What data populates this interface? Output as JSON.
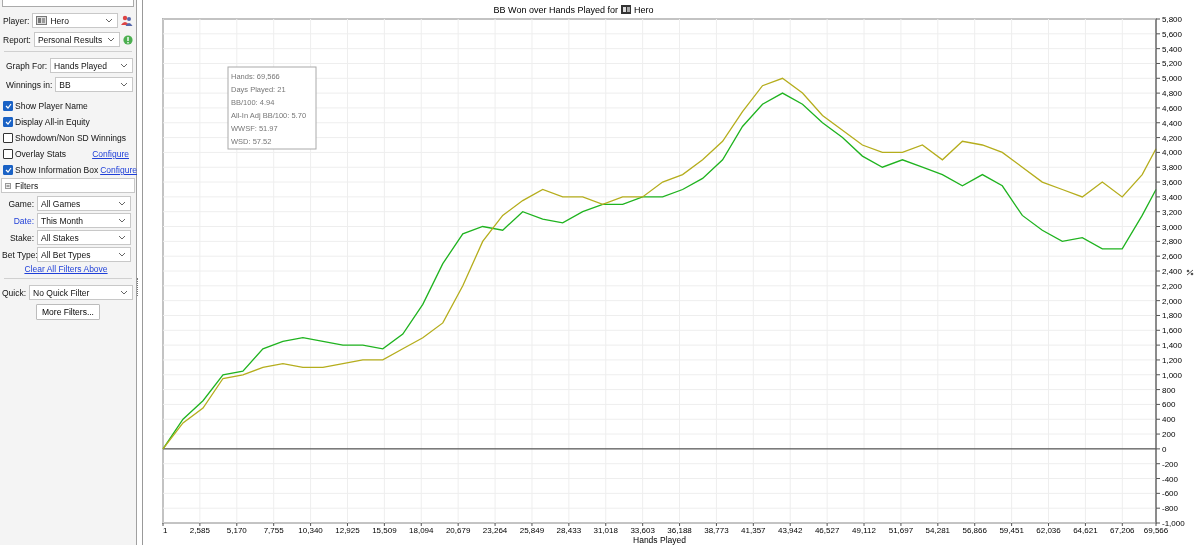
{
  "sidebar": {
    "player": {
      "label": "Player:",
      "value": "Hero"
    },
    "report": {
      "label": "Report:",
      "value": "Personal Results"
    },
    "graph_for": {
      "label": "Graph For:",
      "value": "Hands Played"
    },
    "winnings_in": {
      "label": "Winnings in:",
      "value": "BB"
    },
    "options": [
      {
        "label": "Show Player Name",
        "checked": true
      },
      {
        "label": "Display All-in Equity",
        "checked": true
      },
      {
        "label": "Showdown/Non SD Winnings",
        "checked": false
      },
      {
        "label": "Overlay Stats",
        "checked": false,
        "link": "Configure"
      },
      {
        "label": "Show Information Box",
        "checked": true,
        "link": "Configure"
      }
    ],
    "filters": {
      "title": "Filters",
      "expanded": true,
      "items": [
        {
          "label": "Game:",
          "value": "All Games",
          "modified": false
        },
        {
          "label": "Date:",
          "value": "This Month",
          "modified": true
        },
        {
          "label": "Stake:",
          "value": "All Stakes",
          "modified": false
        },
        {
          "label": "Bet Type:",
          "value": "All Bet Types",
          "modified": false
        }
      ],
      "clear_link": "Clear All Filters Above"
    },
    "quick": {
      "label": "Quick:",
      "value": "No Quick Filter"
    },
    "more_button": "More Filters..."
  },
  "chart": {
    "title_prefix": "BB Won over Hands Played for",
    "player": "Hero",
    "info_box": [
      "Hands: 69,566",
      "Days Played: 21",
      "BB/100: 4.94",
      "All-In Adj BB/100: 5.70",
      "WWSF: 51.97",
      "WSD: 57.52"
    ],
    "chart_data": {
      "type": "line",
      "grid": true,
      "xlabel": "Hands Played",
      "xlim": [
        1,
        69566
      ],
      "ylim": [
        -1000,
        5800
      ],
      "x": [
        1,
        1401,
        2801,
        4201,
        5601,
        7001,
        8401,
        9801,
        11201,
        12601,
        14001,
        15401,
        16801,
        18201,
        19601,
        21001,
        22401,
        23801,
        25201,
        26601,
        28001,
        29401,
        30801,
        32201,
        33601,
        35001,
        36401,
        37801,
        39201,
        40601,
        42001,
        43401,
        44801,
        46201,
        47601,
        49001,
        50401,
        51801,
        53201,
        54601,
        56001,
        57401,
        58801,
        60201,
        61601,
        63001,
        64401,
        65801,
        67201,
        68601,
        69566
      ],
      "series": [
        {
          "color": "#1fb31f",
          "values": [
            0,
            400,
            650,
            1000,
            1050,
            1350,
            1450,
            1500,
            1450,
            1400,
            1400,
            1350,
            1550,
            1950,
            2500,
            2900,
            3000,
            2950,
            3200,
            3100,
            3050,
            3200,
            3300,
            3300,
            3400,
            3400,
            3500,
            3650,
            3900,
            4350,
            4650,
            4800,
            4650,
            4400,
            4200,
            3950,
            3800,
            3900,
            3800,
            3700,
            3550,
            3700,
            3550,
            3150,
            2950,
            2800,
            2850,
            2700,
            2700,
            3150,
            3500
          ]
        },
        {
          "color": "#b5ad1c",
          "values": [
            0,
            350,
            550,
            950,
            1000,
            1100,
            1150,
            1100,
            1100,
            1150,
            1200,
            1200,
            1350,
            1500,
            1700,
            2200,
            2800,
            3150,
            3350,
            3500,
            3400,
            3400,
            3300,
            3400,
            3400,
            3600,
            3700,
            3900,
            4150,
            4550,
            4900,
            5000,
            4800,
            4500,
            4300,
            4100,
            4000,
            4000,
            4100,
            3900,
            4150,
            4100,
            4000,
            3800,
            3600,
            3500,
            3400,
            3600,
            3400,
            3700,
            4050
          ]
        }
      ],
      "xticks": [
        {
          "value": 1,
          "label": "1"
        },
        {
          "value": 2585,
          "label": "2,585"
        },
        {
          "value": 5170,
          "label": "5,170"
        },
        {
          "value": 7755,
          "label": "7,755"
        },
        {
          "value": 10340,
          "label": "10,340"
        },
        {
          "value": 12925,
          "label": "12,925"
        },
        {
          "value": 15509,
          "label": "15,509"
        },
        {
          "value": 18094,
          "label": "18,094"
        },
        {
          "value": 20679,
          "label": "20,679"
        },
        {
          "value": 23264,
          "label": "23,264"
        },
        {
          "value": 25849,
          "label": "25,849"
        },
        {
          "value": 28433,
          "label": "28,433"
        },
        {
          "value": 31018,
          "label": "31,018"
        },
        {
          "value": 33603,
          "label": "33,603"
        },
        {
          "value": 36188,
          "label": "36,188"
        },
        {
          "value": 38773,
          "label": "38,773"
        },
        {
          "value": 41357,
          "label": "41,357"
        },
        {
          "value": 43942,
          "label": "43,942"
        },
        {
          "value": 46527,
          "label": "46,527"
        },
        {
          "value": 49112,
          "label": "49,112"
        },
        {
          "value": 51697,
          "label": "51,697"
        },
        {
          "value": 54281,
          "label": "54,281"
        },
        {
          "value": 56866,
          "label": "56,866"
        },
        {
          "value": 59451,
          "label": "59,451"
        },
        {
          "value": 62036,
          "label": "62,036"
        },
        {
          "value": 64621,
          "label": "64,621"
        },
        {
          "value": 67206,
          "label": "67,206"
        },
        {
          "value": 69566,
          "label": "69,566"
        }
      ],
      "yticks": [
        {
          "value": 5800,
          "label": "5,800"
        },
        {
          "value": 5600,
          "label": "5,600"
        },
        {
          "value": 5400,
          "label": "5,400"
        },
        {
          "value": 5200,
          "label": "5,200"
        },
        {
          "value": 5000,
          "label": "5,000"
        },
        {
          "value": 4800,
          "label": "4,800"
        },
        {
          "value": 4600,
          "label": "4,600"
        },
        {
          "value": 4400,
          "label": "4,400"
        },
        {
          "value": 4200,
          "label": "4,200"
        },
        {
          "value": 4000,
          "label": "4,000"
        },
        {
          "value": 3800,
          "label": "3,800"
        },
        {
          "value": 3600,
          "label": "3,600"
        },
        {
          "value": 3400,
          "label": "3,400"
        },
        {
          "value": 3200,
          "label": "3,200"
        },
        {
          "value": 3000,
          "label": "3,000"
        },
        {
          "value": 2800,
          "label": "2,800"
        },
        {
          "value": 2600,
          "label": "2,600"
        },
        {
          "value": 2400,
          "label": "2,400"
        },
        {
          "value": 2200,
          "label": "2,200"
        },
        {
          "value": 2000,
          "label": "2,000"
        },
        {
          "value": 1800,
          "label": "1,800"
        },
        {
          "value": 1600,
          "label": "1,600"
        },
        {
          "value": 1400,
          "label": "1,400"
        },
        {
          "value": 1200,
          "label": "1,200"
        },
        {
          "value": 1000,
          "label": "1,000"
        },
        {
          "value": 800,
          "label": "800"
        },
        {
          "value": 600,
          "label": "600"
        },
        {
          "value": 400,
          "label": "400"
        },
        {
          "value": 200,
          "label": "200"
        },
        {
          "value": 0,
          "label": "0"
        },
        {
          "value": -200,
          "label": "-200"
        },
        {
          "value": -400,
          "label": "-400"
        },
        {
          "value": -600,
          "label": "-600"
        },
        {
          "value": -800,
          "label": "-800"
        },
        {
          "value": -1000,
          "label": "-1,000"
        }
      ]
    }
  }
}
